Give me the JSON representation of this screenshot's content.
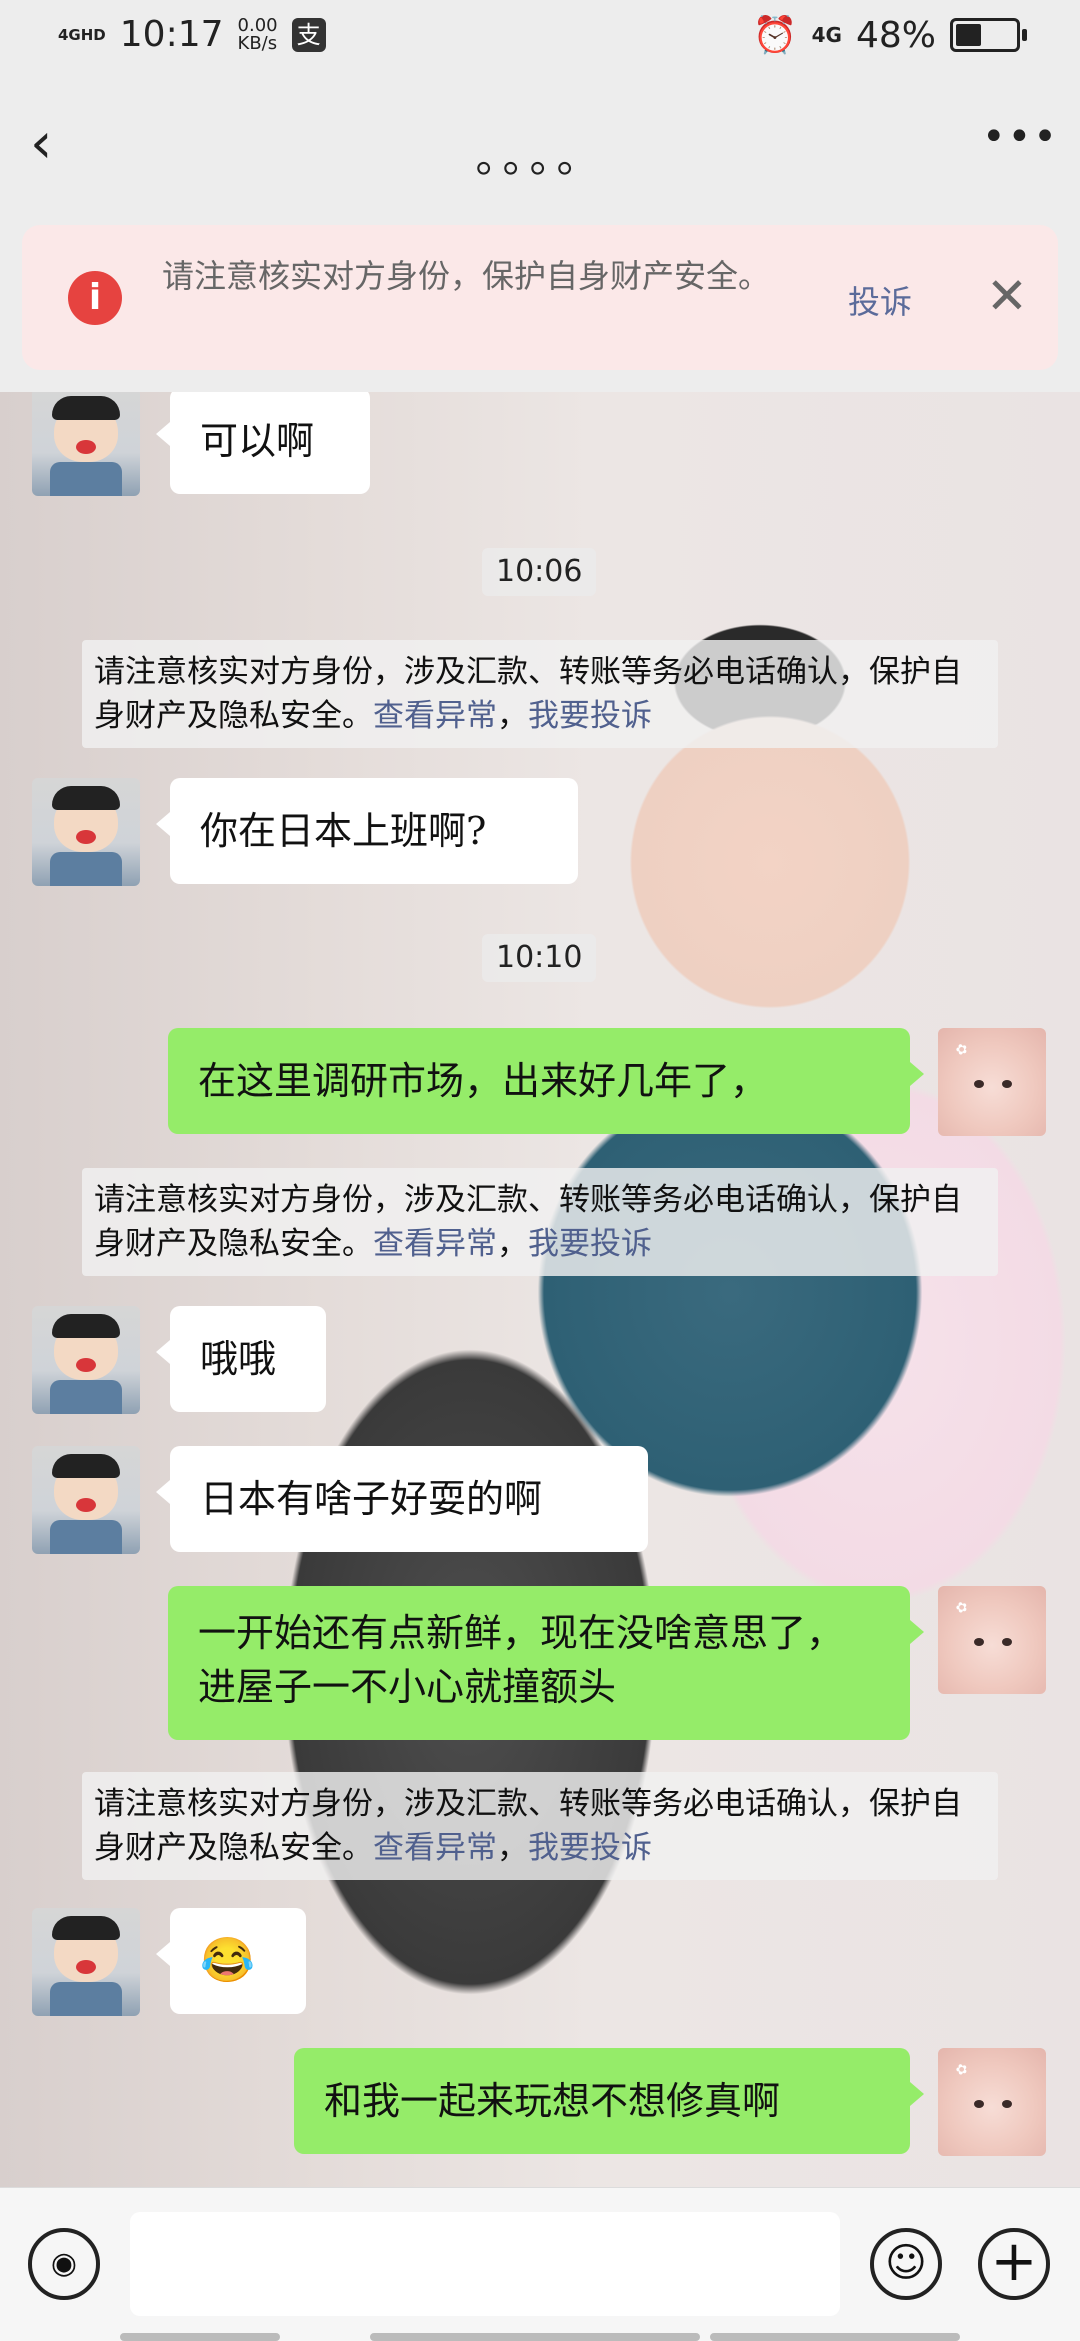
{
  "status_bar": {
    "network": "4GHD",
    "time": "10:17",
    "speed_value": "0.00",
    "speed_unit": "KB/s",
    "pay_icon": "支",
    "network_right": "4G",
    "battery_percent": "48%",
    "battery_level": 0.48
  },
  "header": {
    "back_icon": "chevron-left-icon",
    "title": "。。。。",
    "more_icon": "more-dots-icon"
  },
  "alert": {
    "icon_glyph": "i",
    "text": "请注意核实对方身份，保护自身财产安全。",
    "complain_label": "投诉",
    "close_icon": "close-icon"
  },
  "messages": [
    {
      "type": "in",
      "text": "可以啊"
    },
    {
      "type": "time",
      "text": "10:06"
    },
    {
      "type": "notice",
      "text": "请注意核实对方身份，涉及汇款、转账等务必电话确认，保护自身财产及隐私安全。",
      "link1": "查看异常",
      "sep": "，",
      "link2": "我要投诉"
    },
    {
      "type": "in",
      "text": "你在日本上班啊?"
    },
    {
      "type": "time",
      "text": "10:10"
    },
    {
      "type": "out",
      "text": "在这里调研市场，出来好几年了，"
    },
    {
      "type": "notice",
      "text": "请注意核实对方身份，涉及汇款、转账等务必电话确认，保护自身财产及隐私安全。",
      "link1": "查看异常",
      "sep": "，",
      "link2": "我要投诉"
    },
    {
      "type": "in",
      "text": "哦哦"
    },
    {
      "type": "in",
      "text": "日本有啥子好耍的啊"
    },
    {
      "type": "out",
      "text": "一开始还有点新鲜，现在没啥意思了，进屋子一不小心就撞额头"
    },
    {
      "type": "notice",
      "text": "请注意核实对方身份，涉及汇款、转账等务必电话确认，保护自身财产及隐私安全。",
      "link1": "查看异常",
      "sep": "，",
      "link2": "我要投诉"
    },
    {
      "type": "in",
      "text": "😂"
    },
    {
      "type": "out",
      "text": "和我一起来玩想不想修真啊"
    }
  ],
  "bottom_bar": {
    "voice_icon": "voice-icon",
    "voice_glyph": "◉",
    "input_value": "",
    "emoji_icon": "emoji-icon",
    "emoji_glyph": "☺",
    "plus_icon": "plus-icon",
    "plus_glyph": "+"
  },
  "colors": {
    "sent_bubble": "#95ec69",
    "received_bubble": "#ffffff",
    "alert_bg": "#fbe8e8",
    "alert_icon": "#e64340",
    "link": "#50608e"
  }
}
